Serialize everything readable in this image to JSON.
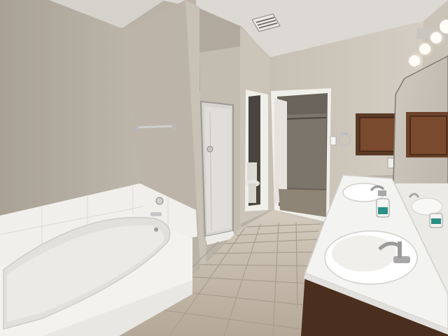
{
  "scene": {
    "subject": "bathroom",
    "objects": [
      "bathtub-icon",
      "shower-stall-icon",
      "toilet-icon",
      "closet-doorway-icon",
      "vanity-sink-icon",
      "mirror-icon",
      "vanity-light-icon",
      "towel-bar-icon",
      "towel-ring-icon",
      "air-vent-icon",
      "medicine-cabinet-icon",
      "tile-floor-icon"
    ],
    "colors": {
      "wall": "#b9b2a6",
      "wall_shadow": "#a59d91",
      "ceiling": "#dcd9d4",
      "tub": "#f1f0ec",
      "floor_tile": "#c6bcb0",
      "grout": "#a89d90",
      "counter": "#f3f3f1",
      "wood_cabinet": "#5a3a26",
      "cabinet_door": "#7a4a2e",
      "light": "#fff8e6"
    }
  }
}
